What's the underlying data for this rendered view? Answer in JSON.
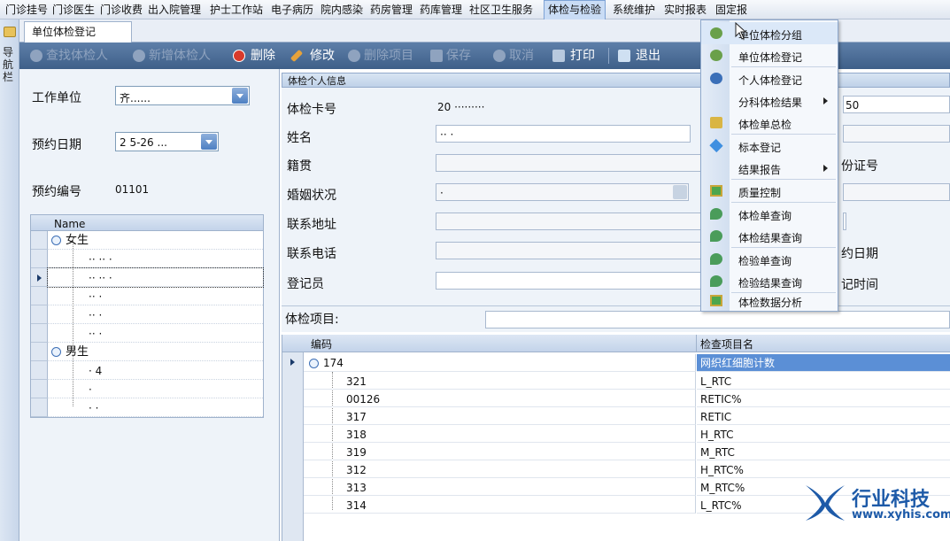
{
  "menubar": {
    "items": [
      "门诊挂号",
      "门诊医生",
      "门诊收费",
      "出入院管理",
      "护士工作站",
      "电子病历",
      "院内感染",
      "药房管理",
      "药库管理",
      "社区卫生服务",
      "体检与检验",
      "系统维护",
      "实时报表",
      "固定报"
    ],
    "active_index": 10
  },
  "navstrip": {
    "label": "导航栏"
  },
  "tab": {
    "label": "单位体检登记"
  },
  "toolbar": {
    "find_label": "查找体检人",
    "add_label": "新增体检人",
    "delete_label": "删除",
    "edit_label": "修改",
    "remove_item_label": "删除项目",
    "save_label": "保存",
    "cancel_label": "取消",
    "print_label": "打印",
    "exit_label": "退出"
  },
  "left": {
    "work_unit_label": "工作单位",
    "work_unit_value": "齐......",
    "appt_date_label": "预约日期",
    "appt_date_value": "2    5-26 ...",
    "appt_no_label": "预约编号",
    "appt_no_value": "01101",
    "tree_header": "Name",
    "groups": [
      {
        "label": "女生",
        "children": [
          "·· ·· ·",
          "·· ·· ·",
          "·· ·",
          "·· ·",
          "·· ·"
        ]
      },
      {
        "label": "男生",
        "children": [
          "·   4",
          "·",
          "·   ·"
        ]
      }
    ]
  },
  "info": {
    "header": "体检个人信息",
    "card_no_label": "体检卡号",
    "card_no_value": "20 ·········",
    "name_label": "姓名",
    "name_value": "·· ·",
    "native_label": "籍贯",
    "marital_label": "婚姻状况",
    "marital_value": "·",
    "address_label": "联系地址",
    "phone_label": "联系电话",
    "registrar_label": "登记员",
    "right_value_1": "50",
    "right_label_id": "份证号",
    "right_label_date": "约日期",
    "right_label_time": "记时间"
  },
  "items_bar": {
    "label": "体检项目:"
  },
  "grid": {
    "col_code": "编码",
    "col_name": "检查项目名",
    "parent": {
      "code": "174",
      "name": "网织红细胞计数"
    },
    "rows": [
      {
        "code": "321",
        "name": "L_RTC"
      },
      {
        "code": "00126",
        "name": "RETIC%"
      },
      {
        "code": "317",
        "name": "RETIC"
      },
      {
        "code": "318",
        "name": "H_RTC"
      },
      {
        "code": "319",
        "name": "M_RTC"
      },
      {
        "code": "312",
        "name": "H_RTC%"
      },
      {
        "code": "313",
        "name": "M_RTC%"
      },
      {
        "code": "314",
        "name": "L_RTC%"
      }
    ]
  },
  "dropmenu": {
    "items": [
      {
        "label": "单位体检分组",
        "icon": "group-icon"
      },
      {
        "label": "单位体检登记",
        "icon": "group-icon"
      },
      {
        "label": "个人体检登记",
        "icon": "person-icon"
      },
      {
        "label": "分科体检结果",
        "icon": "",
        "submenu": true
      },
      {
        "label": "体检单总检",
        "icon": "review-icon"
      },
      {
        "label": "标本登记",
        "icon": "diamond-icon"
      },
      {
        "label": "结果报告",
        "icon": "",
        "submenu": true
      },
      {
        "label": "质量控制",
        "icon": "quality-icon"
      },
      {
        "label": "体检单查询",
        "icon": "query-icon"
      },
      {
        "label": "体检结果查询",
        "icon": "query-icon"
      },
      {
        "label": "检验单查询",
        "icon": "query-icon"
      },
      {
        "label": "检验结果查询",
        "icon": "query-icon"
      },
      {
        "label": "体检数据分析",
        "icon": "analysis-icon"
      }
    ]
  },
  "watermark": {
    "name": "行业科技",
    "url": "www.xyhis.com"
  },
  "colors": {
    "toolbar": "#4a6b94",
    "menu_highlight": "#c9dcf5",
    "selected_cell": "#5b8fd6"
  }
}
